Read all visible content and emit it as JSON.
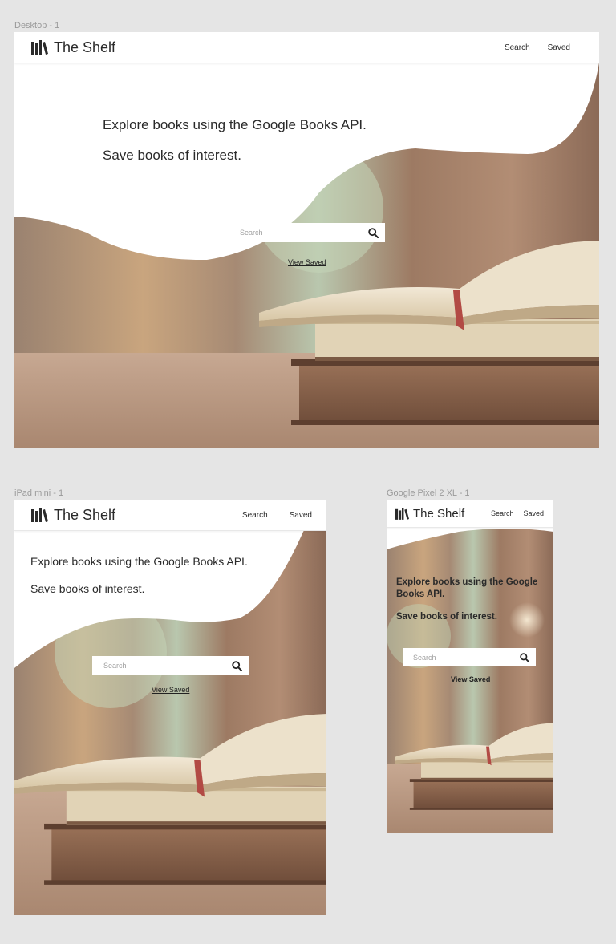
{
  "frames": {
    "desktop": {
      "label": "Desktop - 1",
      "brand": "The Shelf",
      "nav": {
        "search": "Search",
        "saved": "Saved"
      },
      "hero": {
        "line1": "Explore books using the Google Books API.",
        "line2": "Save books of interest."
      },
      "search": {
        "placeholder": "Search"
      },
      "view_saved": "View Saved"
    },
    "ipad": {
      "label": "iPad mini - 1",
      "brand": "The Shelf",
      "nav": {
        "search": "Search",
        "saved": "Saved"
      },
      "hero": {
        "line1": "Explore books using the Google Books API.",
        "line2": "Save books of interest."
      },
      "search": {
        "placeholder": "Search"
      },
      "view_saved": "View Saved"
    },
    "pixel": {
      "label": "Google Pixel 2 XL - 1",
      "brand": "The Shelf",
      "nav": {
        "search": "Search",
        "saved": "Saved"
      },
      "hero": {
        "line1": "Explore books using the Google Books API.",
        "line2": "Save books of interest."
      },
      "search": {
        "placeholder": "Search"
      },
      "view_saved": "View Saved"
    }
  },
  "icons": {
    "logo": "bookshelf-icon",
    "search": "search-icon"
  },
  "colors": {
    "canvas": "#e5e5e5",
    "navbar": "#ffffff",
    "text": "#2a2a2a",
    "wood": "#8a6248"
  }
}
